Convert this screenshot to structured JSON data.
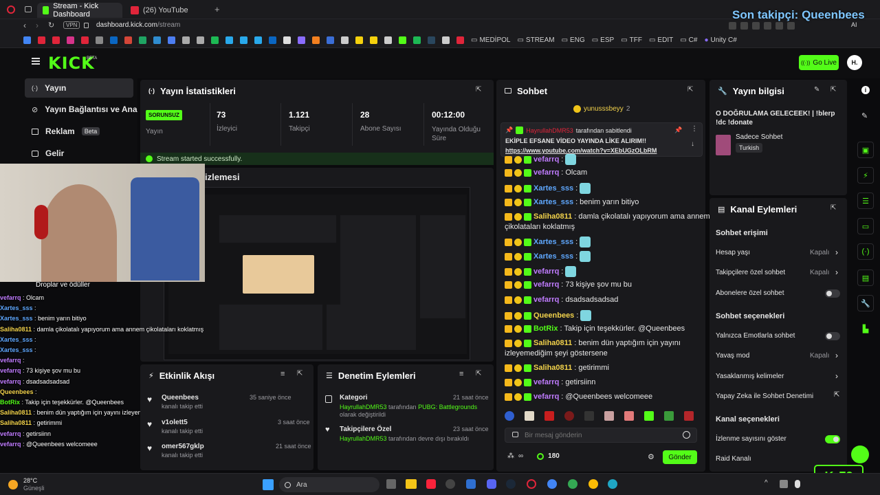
{
  "browser": {
    "tabs": [
      {
        "label": "Stream - Kick Dashboard",
        "active": true
      },
      {
        "label": "(26) YouTube",
        "active": false
      }
    ],
    "vpn_label": "VPN",
    "url_host": "dashboard.kick.com",
    "url_path": "/stream",
    "ai_label": "AI",
    "bookmark_folders": [
      "MEDİPOL",
      "STREAM",
      "ENG",
      "ESP",
      "TFF",
      "EDIT",
      "C#",
      "Unity C#"
    ]
  },
  "stream_overlay": {
    "last_follower": "Son takipçi: Queenbees",
    "drops_label": "Droplar ve ödüller",
    "viewer_counter": "73",
    "chat_overlay": [
      {
        "user": "vefarrq",
        "color": "#c07cff",
        "msg": "Olcam"
      },
      {
        "user": "Xartes_sss",
        "color": "#5fa8ff",
        "msg": ""
      },
      {
        "user": "Xartes_sss",
        "color": "#5fa8ff",
        "msg": "benim yarın bitiyo"
      },
      {
        "user": "Saliha0811",
        "color": "#f2d24b",
        "msg": "damla çikolatalı yapıyorum ama annem çikolataları koklatmış"
      },
      {
        "user": "Xartes_sss",
        "color": "#5fa8ff",
        "msg": ""
      },
      {
        "user": "Xartes_sss",
        "color": "#5fa8ff",
        "msg": ""
      },
      {
        "user": "vefarrq",
        "color": "#c07cff",
        "msg": ""
      },
      {
        "user": "vefarrq",
        "color": "#c07cff",
        "msg": "73 kişiye şov mu bu"
      },
      {
        "user": "vefarrq",
        "color": "#c07cff",
        "msg": "dsadsadsadsad"
      },
      {
        "user": "Queenbees",
        "color": "#f2d24b",
        "msg": ""
      },
      {
        "user": "BotRix",
        "color": "#53fc18",
        "msg": "Takip için teşekkürler. @Queenbees"
      },
      {
        "user": "Saliha0811",
        "color": "#f2d24b",
        "msg": "benim dün yaptığım için yayını izleyemediğim şeyi göstersene"
      },
      {
        "user": "Saliha0811",
        "color": "#f2d24b",
        "msg": "getirimmi"
      },
      {
        "user": "vefarrq",
        "color": "#c07cff",
        "msg": "getirsiinn"
      },
      {
        "user": "vefarrq",
        "color": "#c07cff",
        "msg": "@Queenbees welcomeee"
      }
    ]
  },
  "header": {
    "logo": "KICK",
    "logo_beta": "BETA",
    "go_live": "Go Live",
    "avatar_initial": "H."
  },
  "sidebar": {
    "items": [
      {
        "label": "Yayın",
        "active": true
      },
      {
        "label": "Yayın Bağlantısı ve Anahtar",
        "active": false
      },
      {
        "label": "Reklam",
        "badge": "Beta"
      },
      {
        "label": "Gelir",
        "active": false
      }
    ]
  },
  "stats": {
    "title": "Yayın İstatistikleri",
    "status_badge": "SORUNSUZ",
    "status_label": "Yayın",
    "viewers": {
      "value": "73",
      "label": "İzleyici"
    },
    "followers": {
      "value": "1.121",
      "label": "Takipçi"
    },
    "subscribers": {
      "value": "28",
      "label": "Abone Sayısı"
    },
    "duration": {
      "value": "00:12:00",
      "label": "Yayında Olduğu Süre"
    },
    "success_msg": "Stream started successfully."
  },
  "preview": {
    "title_partial": "izlemesi"
  },
  "activity": {
    "title": "Etkinlik Akışı",
    "items": [
      {
        "user": "Queenbees",
        "action": "kanalı takip etti",
        "time": "35 saniye önce"
      },
      {
        "user": "v1olett5",
        "action": "kanalı takip etti",
        "time": "3 saat önce"
      },
      {
        "user": "omer567gklp",
        "action": "kanalı takip etti",
        "time": "21 saat önce"
      }
    ]
  },
  "moderation": {
    "title": "Denetim Eylemleri",
    "items": [
      {
        "title": "Kategori",
        "time": "21 saat önce",
        "actor": "HayrullahDMR53",
        "mid": " tarafından ",
        "target": "PUBG: Battlegrounds",
        "tail": "olarak değiştirildi"
      },
      {
        "title": "Takipçilere Özel",
        "time": "23 saat önce",
        "actor": "HayrullahDMR53",
        "mid": " tarafından devre dışı bırakıldı",
        "target": "",
        "tail": ""
      }
    ]
  },
  "chat": {
    "title": "Sohbet",
    "top_user": "yunusssbeyy",
    "top_count": "2",
    "pinned_by_user": "HayrullahDMR53",
    "pinned_by_suffix": "tarafından sabitlendi",
    "pinned_text": "EKİPLE EFSANE VİDEO YAYINDA LİKE ALIRIM!!",
    "pinned_link": "https://www.youtube.com/watch?v=XEbUGzOLbRM",
    "messages": [
      {
        "user": "vefarrq",
        "color": "#c07cff",
        "msg": ""
      },
      {
        "user": "vefarrq",
        "color": "#c07cff",
        "msg": "Olcam"
      },
      {
        "user": "Xartes_sss",
        "color": "#5fa8ff",
        "msg": ""
      },
      {
        "user": "Xartes_sss",
        "color": "#5fa8ff",
        "msg": "benim yarın bitiyo"
      },
      {
        "user": "Saliha0811",
        "color": "#f2d24b",
        "msg": "damla çikolatalı yapıyorum ama annem"
      },
      {
        "user": "",
        "color": "#e7e7e7",
        "msg": "çikolataları koklatmış"
      },
      {
        "user": "Xartes_sss",
        "color": "#5fa8ff",
        "msg": ""
      },
      {
        "user": "Xartes_sss",
        "color": "#5fa8ff",
        "msg": ""
      },
      {
        "user": "vefarrq",
        "color": "#c07cff",
        "msg": ""
      },
      {
        "user": "vefarrq",
        "color": "#c07cff",
        "msg": "73 kişiye şov mu bu"
      },
      {
        "user": "vefarrq",
        "color": "#c07cff",
        "msg": "dsadsadsadsad"
      },
      {
        "user": "Queenbees",
        "color": "#f2d24b",
        "msg": ""
      },
      {
        "user": "BotRix",
        "color": "#53fc18",
        "msg": "Takip için teşekkürler. @Queenbees"
      },
      {
        "user": "Saliha0811",
        "color": "#f2d24b",
        "msg": "benim dün yaptığım için yayını"
      },
      {
        "user": "",
        "color": "#e7e7e7",
        "msg": "izleyemediğim şeyi göstersene"
      },
      {
        "user": "Saliha0811",
        "color": "#f2d24b",
        "msg": "getirimmi"
      },
      {
        "user": "vefarrq",
        "color": "#c07cff",
        "msg": "getirsiinn"
      },
      {
        "user": "vefarrq",
        "color": "#c07cff",
        "msg": "@Queenbees welcomeee"
      }
    ],
    "input_placeholder": "Bir mesaj gönderin",
    "points": "180",
    "send_label": "Gönder"
  },
  "stream_info": {
    "title": "Yayın bilgisi",
    "stream_title": "O DOĞRULAMA GELECEEK! | !blerp !dc !donate",
    "category": "Sadece Sohbet",
    "language": "Turkish"
  },
  "channel_actions": {
    "title": "Kanal Eylemleri",
    "chat_access": "Sohbet erişimi",
    "account_age": {
      "label": "Hesap yaşı",
      "value": "Kapalı"
    },
    "followers_only": {
      "label": "Takipçilere özel sohbet",
      "value": "Kapalı"
    },
    "subscribers_only": {
      "label": "Abonelere özel sohbet",
      "on": false
    },
    "chat_options": "Sohbet seçenekleri",
    "emotes_only": {
      "label": "Yalnızca Emotlarla sohbet",
      "on": false
    },
    "slow_mode": {
      "label": "Yavaş mod",
      "value": "Kapalı"
    },
    "banned_words": "Yasaklanmış kelimeler",
    "ai_moderation": "Yapay Zeka ile Sohbet Denetimi",
    "channel_options": "Kanal seçenekleri",
    "show_viewers": {
      "label": "İzlenme sayısını göster",
      "on": true
    },
    "raid": "Raid Kanalı"
  },
  "taskbar": {
    "temp": "28°C",
    "weather": "Güneşli",
    "search": "Ara"
  },
  "colors": {
    "accent": "#53fc18",
    "panel": "#19191c",
    "background": "#0b0b0d"
  }
}
